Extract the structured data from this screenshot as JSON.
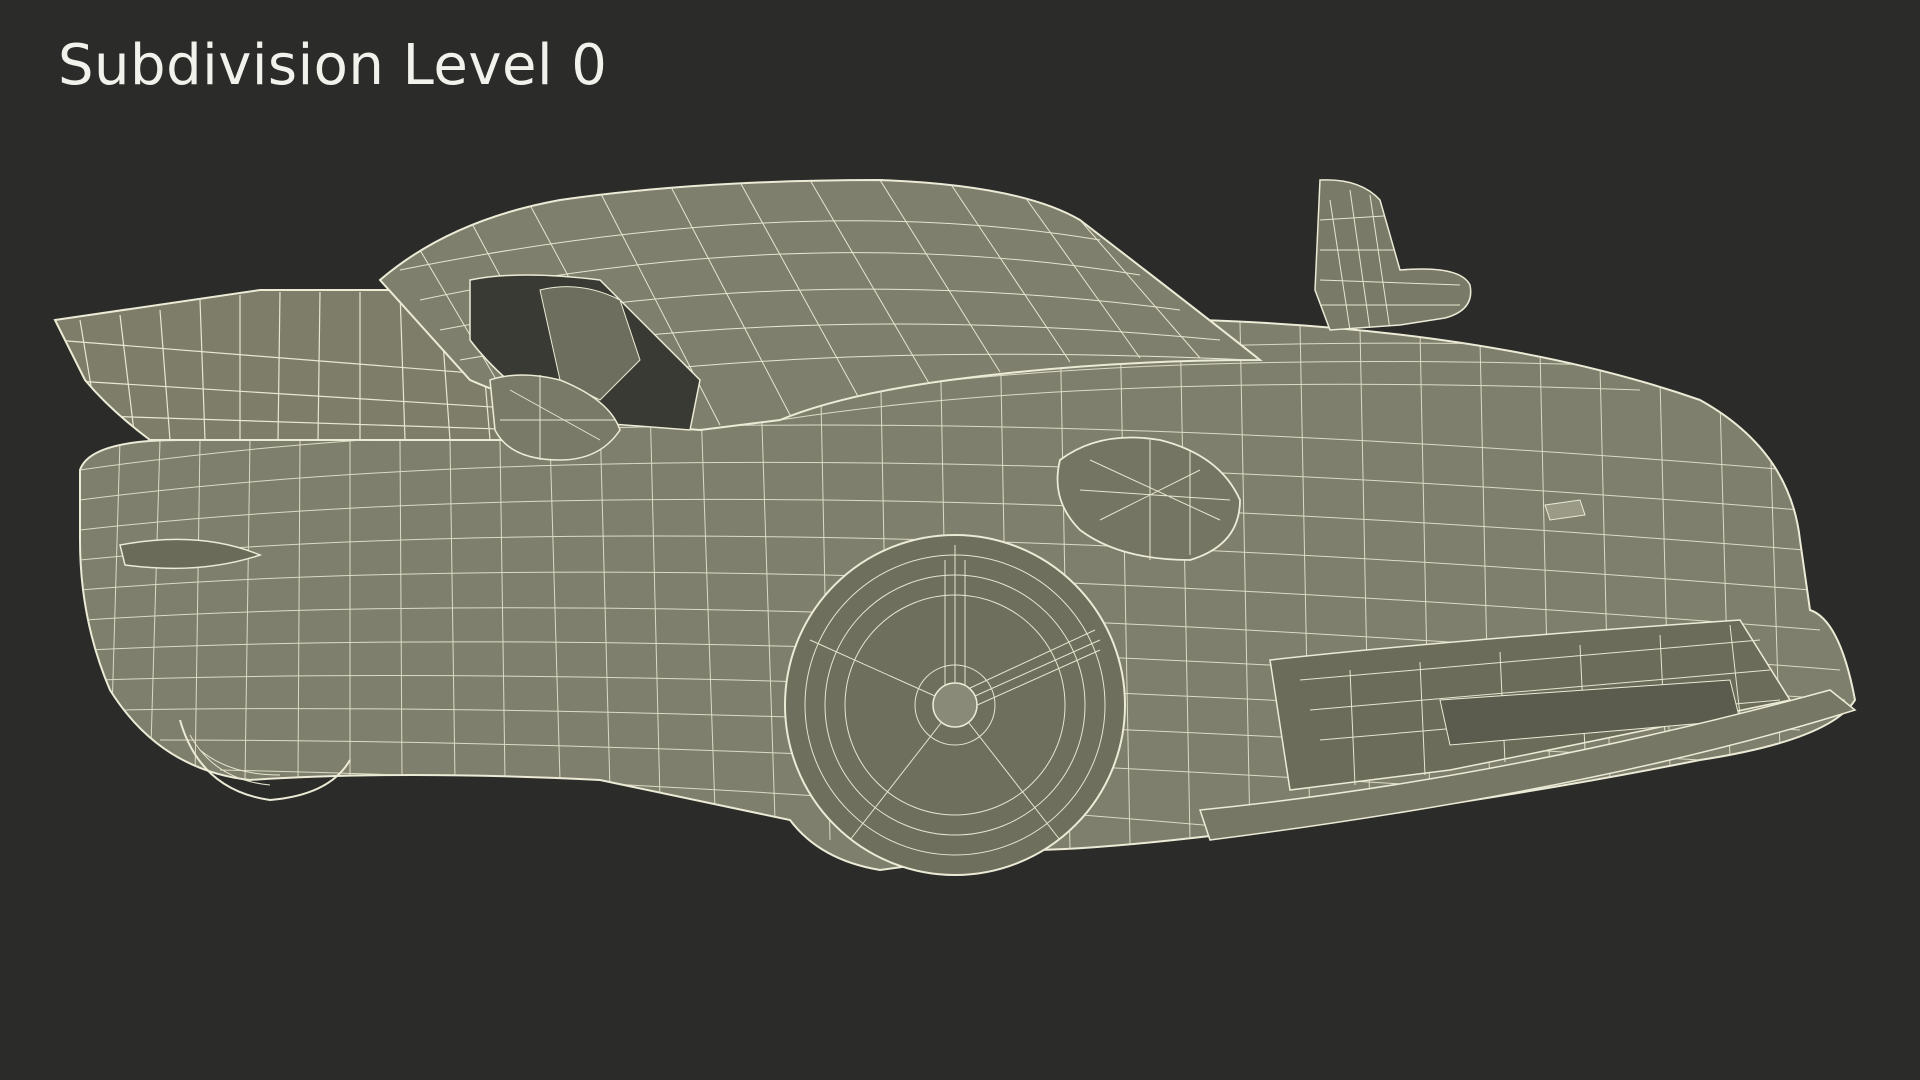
{
  "title": "Subdivision Level 0",
  "colors": {
    "background": "#2b2b2a",
    "surface": "#7f7f6d",
    "wire": "#ecebd6",
    "title_text": "#f2f2ec"
  },
  "subject": "car-wireframe"
}
